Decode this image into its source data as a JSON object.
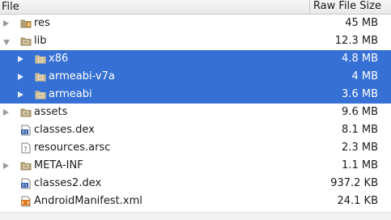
{
  "header": {
    "file_label": "File",
    "size_label": "Raw File Size"
  },
  "rows": [
    {
      "name": "res",
      "size": "45 MB",
      "icon": "resource-folder-icon",
      "arrow": "collapsed",
      "level": 0,
      "selected": false
    },
    {
      "name": "lib",
      "size": "12.3 MB",
      "icon": "folder-icon",
      "arrow": "expanded",
      "level": 0,
      "selected": false
    },
    {
      "name": "x86",
      "size": "4.8 MB",
      "icon": "folder-icon",
      "arrow": "collapsed",
      "level": 1,
      "selected": true
    },
    {
      "name": "armeabi-v7a",
      "size": "4 MB",
      "icon": "folder-icon",
      "arrow": "collapsed",
      "level": 1,
      "selected": true
    },
    {
      "name": "armeabi",
      "size": "3.6 MB",
      "icon": "folder-icon",
      "arrow": "collapsed",
      "level": 1,
      "selected": true
    },
    {
      "name": "assets",
      "size": "9.6 MB",
      "icon": "folder-icon",
      "arrow": "collapsed",
      "level": 0,
      "selected": false
    },
    {
      "name": "classes.dex",
      "size": "8.1 MB",
      "icon": "dex-file-icon",
      "arrow": "none",
      "level": 0,
      "selected": false
    },
    {
      "name": "resources.arsc",
      "size": "2.3 MB",
      "icon": "unknown-file-icon",
      "arrow": "none",
      "level": 0,
      "selected": false
    },
    {
      "name": "META-INF",
      "size": "1.1 MB",
      "icon": "folder-icon",
      "arrow": "collapsed",
      "level": 0,
      "selected": false
    },
    {
      "name": "classes2.dex",
      "size": "937.2 KB",
      "icon": "dex-file-icon",
      "arrow": "none",
      "level": 0,
      "selected": false
    },
    {
      "name": "AndroidManifest.xml",
      "size": "24.1 KB",
      "icon": "xml-file-icon",
      "arrow": "none",
      "level": 0,
      "selected": false
    }
  ],
  "colors": {
    "selection": "#3670d4",
    "folder": "#b1a07a",
    "dex_icon": "#2f5aa8",
    "xml_icon": "#e07a1f"
  }
}
